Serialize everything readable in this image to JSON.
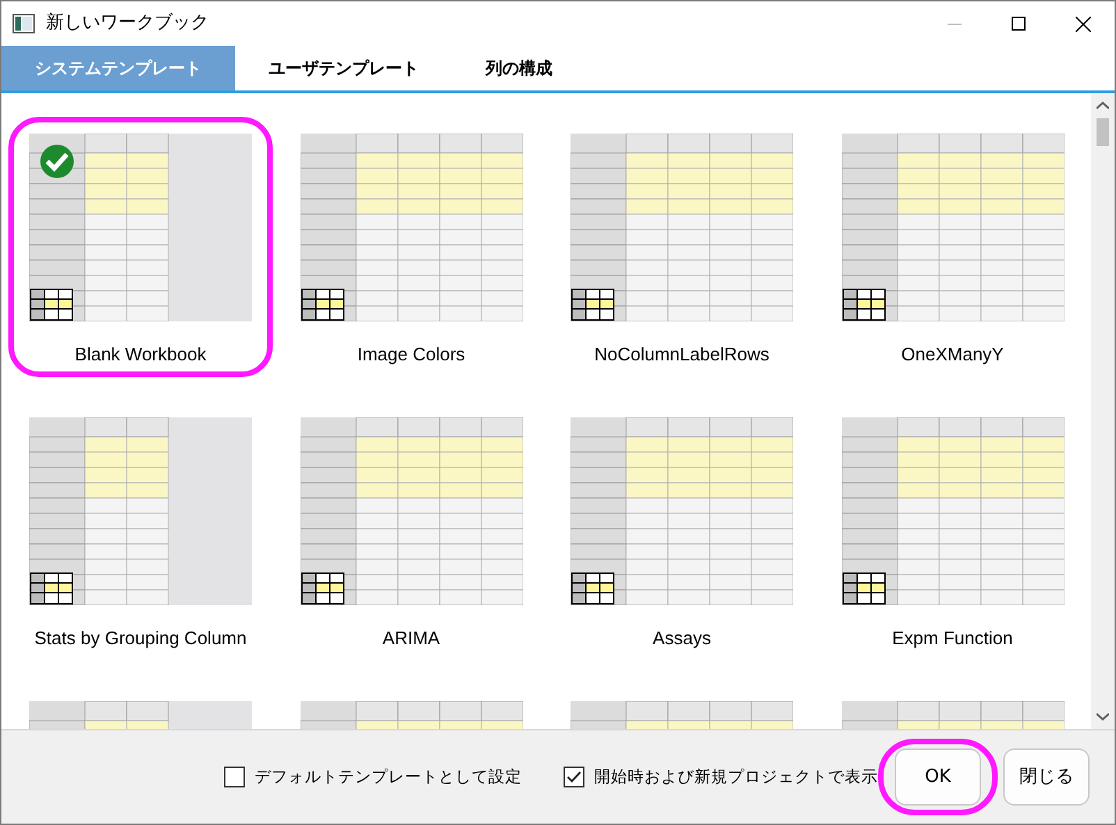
{
  "window": {
    "title": "新しいワークブック",
    "minimize_disabled": true
  },
  "tabs": [
    {
      "label": "システムテンプレート",
      "selected": true
    },
    {
      "label": "ユーザテンプレート",
      "selected": false
    },
    {
      "label": "列の構成",
      "selected": false
    }
  ],
  "templates": [
    {
      "label": "Blank Workbook",
      "selected": true,
      "highlighted": true
    },
    {
      "label": "Image Colors",
      "selected": false,
      "highlighted": false
    },
    {
      "label": "NoColumnLabelRows",
      "selected": false,
      "highlighted": false
    },
    {
      "label": "OneXManyY",
      "selected": false,
      "highlighted": false
    },
    {
      "label": "Stats by Grouping Column",
      "selected": false,
      "highlighted": false
    },
    {
      "label": "ARIMA",
      "selected": false,
      "highlighted": false
    },
    {
      "label": "Assays",
      "selected": false,
      "highlighted": false
    },
    {
      "label": "Expm Function",
      "selected": false,
      "highlighted": false
    },
    {
      "selected": false,
      "highlighted": false
    },
    {
      "selected": false,
      "highlighted": false
    },
    {
      "selected": false,
      "highlighted": false
    },
    {
      "selected": false,
      "highlighted": false
    }
  ],
  "options": [
    {
      "label": "デフォルトテンプレートとして設定",
      "checked": false
    },
    {
      "label": "開始時および新規プロジェクトで表示",
      "checked": true
    }
  ],
  "buttons": [
    {
      "label": "OK",
      "highlighted": true
    },
    {
      "label": "閉じる",
      "highlighted": false
    }
  ]
}
